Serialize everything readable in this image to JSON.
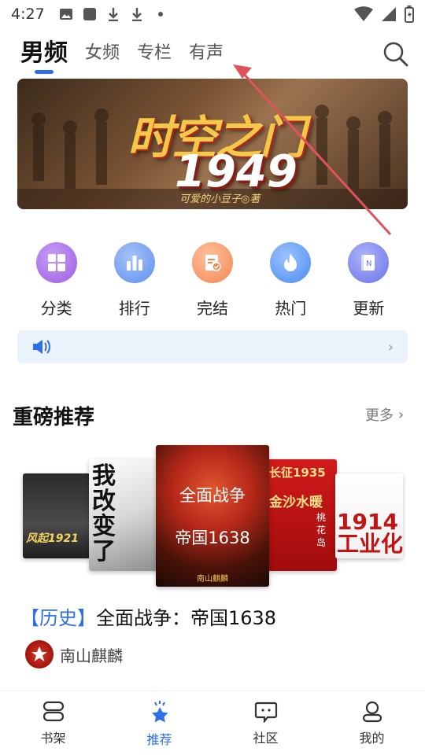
{
  "status_bar": {
    "time": "4:27"
  },
  "top_tabs": [
    {
      "label": "男频",
      "active": true
    },
    {
      "label": "女频",
      "active": false
    },
    {
      "label": "专栏",
      "active": false
    },
    {
      "label": "有声",
      "active": false
    }
  ],
  "banner": {
    "title": "时空之门",
    "year": "1949",
    "author": "可爱的小豆子◎著"
  },
  "categories": [
    {
      "label": "分类",
      "icon": "grid-icon",
      "color": "#a56ce8"
    },
    {
      "label": "排行",
      "icon": "bar-chart-icon",
      "color": "#6e9cf2"
    },
    {
      "label": "完结",
      "icon": "check-document-icon",
      "color": "#f59a6a"
    },
    {
      "label": "热门",
      "icon": "flame-icon",
      "color": "#5a96f5"
    },
    {
      "label": "更新",
      "icon": "notebook-icon",
      "color": "#7a86ee"
    }
  ],
  "section": {
    "title": "重磅推荐",
    "more": "更多"
  },
  "covers": {
    "c1": "风起1921",
    "c2": "我改变了",
    "c3_line1": "全面战争",
    "c3_line2": "帝国1638",
    "c3_author": "南山麒麟",
    "c4_top": "长征1935",
    "c4_mid": "金沙水暖",
    "c4_side": "桃花岛",
    "c5": "1914工业化"
  },
  "featured_book": {
    "genre": "【历史】",
    "title": "全面战争：帝国1638",
    "author": "南山麒麟"
  },
  "bottom_nav": [
    {
      "label": "书架",
      "icon": "bookshelf-icon",
      "active": false
    },
    {
      "label": "推荐",
      "icon": "star-icon",
      "active": true
    },
    {
      "label": "社区",
      "icon": "chat-icon",
      "active": false
    },
    {
      "label": "我的",
      "icon": "user-icon",
      "active": false
    }
  ],
  "colors": {
    "accent": "#2f6fe6",
    "annotation_arrow": "#e0535a"
  }
}
